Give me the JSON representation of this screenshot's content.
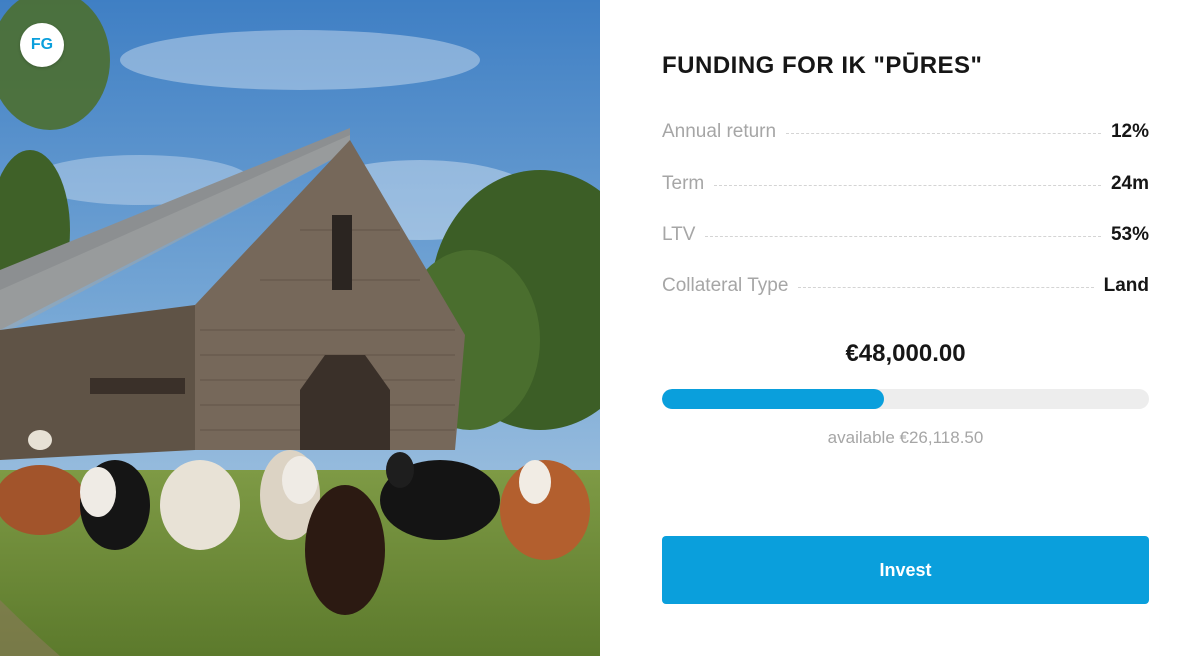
{
  "brand": {
    "badge_text": "FG",
    "accent_color": "#0a9fdc"
  },
  "hero_image": {
    "subject": "barn-with-cattle-photo"
  },
  "offer": {
    "title": "FUNDING FOR IK \"PŪRES\"",
    "details": [
      {
        "label": "Annual return",
        "value": "12%"
      },
      {
        "label": "Term",
        "value": "24m"
      },
      {
        "label": "LTV",
        "value": "53%"
      },
      {
        "label": "Collateral Type",
        "value": "Land"
      }
    ],
    "amount": "€48,000.00",
    "funded_fraction": 0.456,
    "available_text": "available €26,118.50",
    "invest_label": "Invest"
  }
}
